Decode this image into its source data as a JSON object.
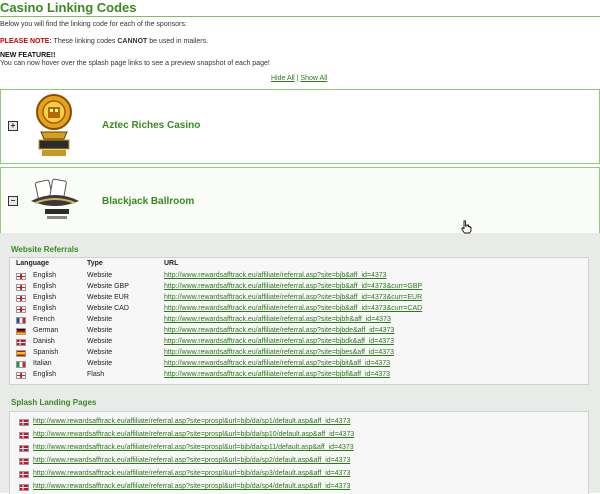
{
  "page": {
    "title": "Casino Linking Codes",
    "intro": "Below you will find the linking code for each of the sponsors:",
    "note_label": "PLEASE NOTE:",
    "note_pre": " These linking codes ",
    "note_bold": "CANNOT",
    "note_post": " be used in mailers.",
    "feature_head": "NEW FEATURE!!",
    "feature_text": "You can now hover over the splash page links to see a preview snapshot of each page!",
    "hide_all": "Hide All",
    "separator": " | ",
    "show_all": "Show All"
  },
  "casinos": [
    {
      "name": "Aztec Riches Casino",
      "toggle": "+"
    },
    {
      "name": "Blackjack Ballroom",
      "toggle": "−"
    }
  ],
  "referrals": {
    "title": "Website Referrals",
    "headers": [
      "Language",
      "Type",
      "URL"
    ],
    "rows": [
      {
        "flag": "uk",
        "language": "English",
        "type": "Website",
        "url": "http://www.rewardsafftrack.eu/affiliate/referral.asp?site=bjb&aff_id=4373"
      },
      {
        "flag": "uk",
        "language": "English",
        "type": "Website GBP",
        "url": "http://www.rewardsafftrack.eu/affiliate/referral.asp?site=bjb&aff_id=4373&curr=GBP"
      },
      {
        "flag": "uk",
        "language": "English",
        "type": "Website EUR",
        "url": "http://www.rewardsafftrack.eu/affiliate/referral.asp?site=bjb&aff_id=4373&curr=EUR"
      },
      {
        "flag": "uk",
        "language": "English",
        "type": "Website CAD",
        "url": "http://www.rewardsafftrack.eu/affiliate/referral.asp?site=bjb&aff_id=4373&curr=CAD"
      },
      {
        "flag": "fr",
        "language": "French",
        "type": "Website",
        "url": "http://www.rewardsafftrack.eu/affiliate/referral.asp?site=bjbfr&aff_id=4373"
      },
      {
        "flag": "de",
        "language": "German",
        "type": "Website",
        "url": "http://www.rewardsafftrack.eu/affiliate/referral.asp?site=bjbde&aff_id=4373"
      },
      {
        "flag": "dk",
        "language": "Danish",
        "type": "Website",
        "url": "http://www.rewardsafftrack.eu/affiliate/referral.asp?site=bjbdk&aff_id=4373"
      },
      {
        "flag": "es",
        "language": "Spanish",
        "type": "Website",
        "url": "http://www.rewardsafftrack.eu/affiliate/referral.asp?site=bjbes&aff_id=4373"
      },
      {
        "flag": "it",
        "language": "Italian",
        "type": "Website",
        "url": "http://www.rewardsafftrack.eu/affiliate/referral.asp?site=bjbit&aff_id=4373"
      },
      {
        "flag": "uk",
        "language": "English",
        "type": "Flash",
        "url": "http://www.rewardsafftrack.eu/affiliate/referral.asp?site=bjbfl&aff_id=4373"
      }
    ]
  },
  "splash": {
    "title": "Splash Landing Pages",
    "rows": [
      {
        "flag": "dk",
        "url": "http://www.rewardsafftrack.eu/affiliate/referral.asp?site=prospl&url=bjb/da/sp1/default.asp&aff_id=4373"
      },
      {
        "flag": "dk",
        "url": "http://www.rewardsafftrack.eu/affiliate/referral.asp?site=prospl&url=bjb/da/sp10/default.asp&aff_id=4373"
      },
      {
        "flag": "dk",
        "url": "http://www.rewardsafftrack.eu/affiliate/referral.asp?site=prospl&url=bjb/da/sp11/default.asp&aff_id=4373"
      },
      {
        "flag": "dk",
        "url": "http://www.rewardsafftrack.eu/affiliate/referral.asp?site=prospl&url=bjb/da/sp2/default.asp&aff_id=4373"
      },
      {
        "flag": "dk",
        "url": "http://www.rewardsafftrack.eu/affiliate/referral.asp?site=prospl&url=bjb/da/sp3/default.asp&aff_id=4373"
      },
      {
        "flag": "dk",
        "url": "http://www.rewardsafftrack.eu/affiliate/referral.asp?site=prospl&url=bjb/da/sp4/default.asp&aff_id=4373"
      }
    ]
  },
  "colors": {
    "brand_green": "#3a8a20",
    "link_green": "#2a7a1a",
    "note_red": "#cc0000",
    "panel_bg": "#e9ebe8"
  }
}
